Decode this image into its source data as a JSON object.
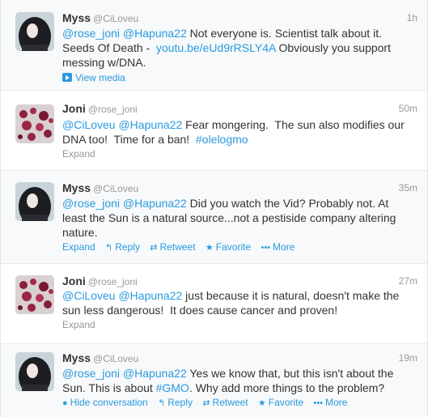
{
  "colors": {
    "accent": "#2a9adf",
    "muted": "#999999",
    "text": "#333333"
  },
  "tweets": [
    {
      "fullname": "Myss",
      "username": "@CiLoveu",
      "time": "1h",
      "lines": [
        [
          [
            "m",
            "@rose_joni"
          ],
          [
            "t",
            " "
          ],
          [
            "m",
            "@Hapuna22"
          ],
          [
            "t",
            " Not everyone is. Scientist talk about it."
          ]
        ],
        [
          [
            "t",
            "Seeds Of Death -  "
          ],
          [
            "l",
            "youtu.be/eUd9rRSLY4A"
          ],
          [
            "t",
            " Obviously you support"
          ]
        ],
        [
          [
            "t",
            "messing w/DNA."
          ]
        ]
      ],
      "view_media": "View media"
    },
    {
      "fullname": "Joni",
      "username": "@rose_joni",
      "time": "50m",
      "lines": [
        [
          [
            "m",
            "@CiLoveu"
          ],
          [
            "t",
            " "
          ],
          [
            "m",
            "@Hapuna22"
          ],
          [
            "t",
            " Fear mongering.  The sun also modifies our"
          ]
        ],
        [
          [
            "t",
            "DNA too!  Time for a ban!  "
          ],
          [
            "h",
            "#olelogmo"
          ]
        ]
      ],
      "expand": "Expand"
    },
    {
      "fullname": "Myss",
      "username": "@CiLoveu",
      "time": "35m",
      "lines": [
        [
          [
            "m",
            "@rose_joni"
          ],
          [
            "t",
            " "
          ],
          [
            "m",
            "@Hapuna22"
          ],
          [
            "t",
            " Did you watch the Vid? Probably not. At"
          ]
        ],
        [
          [
            "t",
            "least the Sun is a natural source...not a pestiside company altering"
          ]
        ],
        [
          [
            "t",
            "nature."
          ]
        ]
      ],
      "actions": {
        "expand": "Expand",
        "reply": "Reply",
        "retweet": "Retweet",
        "favorite": "Favorite",
        "more": "More"
      }
    },
    {
      "fullname": "Joni",
      "username": "@rose_joni",
      "time": "27m",
      "lines": [
        [
          [
            "m",
            "@CiLoveu"
          ],
          [
            "t",
            " "
          ],
          [
            "m",
            "@Hapuna22"
          ],
          [
            "t",
            " just because it is natural, doesn't make the"
          ]
        ],
        [
          [
            "t",
            "sun less dangerous!  It does cause cancer and proven!"
          ]
        ]
      ],
      "expand": "Expand"
    },
    {
      "fullname": "Myss",
      "username": "@CiLoveu",
      "time": "19m",
      "lines": [
        [
          [
            "m",
            "@rose_joni"
          ],
          [
            "t",
            " "
          ],
          [
            "m",
            "@Hapuna22"
          ],
          [
            "t",
            " Yes we know that, but this isn't about the"
          ]
        ],
        [
          [
            "t",
            "Sun. This is about "
          ],
          [
            "h",
            "#GMO"
          ],
          [
            "t",
            ". Why add more things to the problem?"
          ]
        ]
      ],
      "actions": {
        "hide": "Hide conversation",
        "reply": "Reply",
        "retweet": "Retweet",
        "favorite": "Favorite",
        "more": "More"
      }
    }
  ]
}
